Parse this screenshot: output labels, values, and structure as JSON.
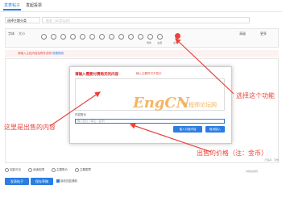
{
  "tabs": [
    {
      "label": "发表帖子"
    },
    {
      "label": "发起投票"
    }
  ],
  "form": {
    "category_select": "选择主题分类",
    "title_placeholder": "帖名（40字以内）"
  },
  "toolbar": {
    "font_label": "字体",
    "size_label": "大小",
    "attachment_label": "附件",
    "theme_label": "主题",
    "paid_label": "出售",
    "advanced_label": "高级",
    "more_label": "更多",
    "icons": [
      "bold-icon",
      "italic-icon",
      "underline-icon",
      "color-icon",
      "link-icon",
      "image-icon",
      "quote-icon",
      "code-icon",
      "smiley-icon",
      "table-icon",
      "flash-icon",
      "paid-content-icon"
    ]
  },
  "hint": {
    "text": "请输入主贴内容及附件说明",
    "link": "查看规则"
  },
  "dialog": {
    "title": "请输入需要付费购买的内容",
    "subtitle": "输入主题时可不显示",
    "price_label": "内容售价",
    "price_placeholder": "输入售价（单位：金币）",
    "confirm_label": "插入付费内容",
    "cancel_label": "取消插入"
  },
  "watermark": {
    "brand": "EngCN",
    "sub": "工程师论坛网"
  },
  "annotations": {
    "select_function": "选择这个功能",
    "selling_content": "这里是出售的内容",
    "selling_price": "出售的价格（注：金币）"
  },
  "status": {
    "text": "已保存 · 字数"
  },
  "options": [
    {
      "label": "回复可见"
    },
    {
      "label": "阅读权限"
    },
    {
      "label": "主题售价"
    },
    {
      "label": "主题图章"
    }
  ],
  "footer": {
    "note": "本版块规则"
  },
  "actions": {
    "post_label": "发表帖子",
    "save_label": "保存草稿",
    "checkbox_label": "接收回复通知"
  },
  "colors": {
    "accent": "#2b7de1",
    "annotation": "#e8453c"
  }
}
